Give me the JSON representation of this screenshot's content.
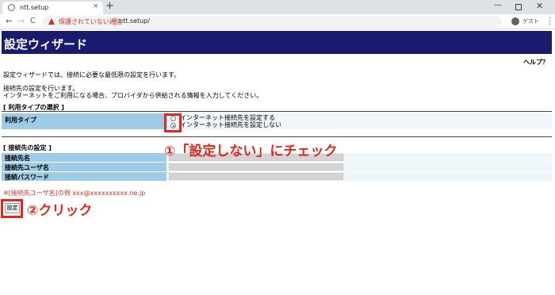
{
  "browser": {
    "tab_title": "ntt.setup",
    "tab_close_glyph": "×",
    "new_tab_glyph": "+",
    "window_minimize_glyph": "—",
    "window_close_glyph": "✕",
    "back_glyph": "←",
    "forward_glyph": "→",
    "reload_glyph": "C",
    "security_warning": "保護されていない通信",
    "url": "ntt.setup/",
    "profile_label": "ゲスト",
    "menu_glyph": "⋮"
  },
  "page": {
    "title": "設定ウィザード",
    "help_link": "ヘルプ？",
    "intro": "設定ウィザードでは、接続に必要な最低限の設定を行います。",
    "conn_desc_line1": "接続先の設定を行います。",
    "conn_desc_line2": "インターネットをご利用になる場合、プロバイダから供給される情報を入力してください。",
    "usage_section_title": "[ 利用タイプの選択 ]",
    "usage_label": "利用タイプ",
    "usage_options": [
      {
        "label": "インターネット接続先を設定する",
        "checked": false
      },
      {
        "label": "インターネット接続先を設定しない",
        "checked": true
      }
    ],
    "conn_section_title": "[ 接続先の設定 ]",
    "fields": [
      {
        "label": "接続先名",
        "value": ""
      },
      {
        "label": "接続先ユーザ名",
        "value": ""
      },
      {
        "label": "接続パスワード",
        "value": ""
      }
    ],
    "example_note": "※[接続先ユーザ名]の例 xxx@xxxxxxxxxx.ne.jp",
    "submit_label": "設定"
  },
  "annotations": {
    "step1_text": "①「設定しない」にチェック",
    "step2_text": "②クリック",
    "color": "#e8251a"
  },
  "colors": {
    "title_bar": "#1a1a6e",
    "label_cell": "#9dcbe8",
    "row_background": "#eef5fb",
    "warning": "#d93025"
  }
}
